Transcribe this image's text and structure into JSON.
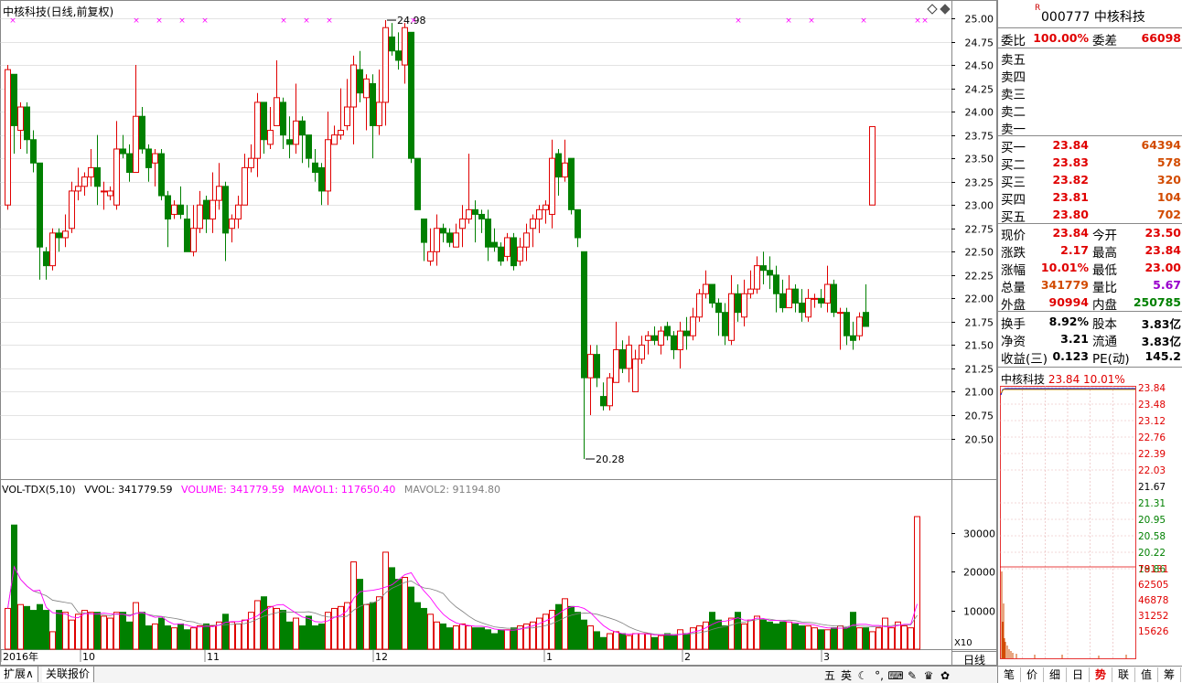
{
  "window": {
    "chart_title": "中核科技(日线,前复权)",
    "period_label": "日线"
  },
  "vol_header": {
    "name": "VOL-TDX(5,10)",
    "vvol": "VVOL: 341779.59",
    "volume": "VOLUME: 341779.59",
    "mavol1": "MAVOL1: 117650.40",
    "mavol2": "MAVOL2: 91194.80"
  },
  "colors": {
    "up": "#e00000",
    "down": "#008000",
    "ma1": "#ff00ff",
    "ma2": "#808080",
    "grid": "#c8c8c8"
  },
  "chart_data": [
    {
      "type": "candlestick",
      "title": "中核科技(日线,前复权)",
      "y_ticks": [
        "25.00",
        "24.75",
        "24.50",
        "24.25",
        "24.00",
        "23.75",
        "23.50",
        "23.25",
        "23.00",
        "22.75",
        "22.50",
        "22.25",
        "22.00",
        "21.75",
        "21.50",
        "21.25",
        "21.00",
        "20.75",
        "20.50"
      ],
      "ylim": [
        20.28,
        25.1
      ],
      "annotations": [
        {
          "label": "24.98",
          "value": 24.98
        },
        {
          "label": "20.28",
          "value": 20.28
        }
      ],
      "x_labels": [
        "2016年",
        "10",
        "11",
        "12",
        "1",
        "2",
        "3"
      ],
      "candles": [
        [
          23.0,
          24.45,
          24.5,
          22.95
        ],
        [
          24.4,
          23.85,
          24.1,
          23.55
        ],
        [
          23.8,
          24.05,
          24.1,
          23.6
        ],
        [
          24.05,
          23.7,
          24.1,
          23.55
        ],
        [
          23.7,
          23.45,
          23.8,
          23.35
        ],
        [
          23.45,
          22.55,
          23.45,
          22.2
        ],
        [
          22.5,
          22.35,
          22.55,
          22.2
        ],
        [
          22.35,
          22.7,
          22.75,
          22.3
        ],
        [
          22.7,
          22.65,
          22.75,
          22.5
        ],
        [
          22.65,
          22.72,
          22.9,
          22.55
        ],
        [
          22.75,
          23.15,
          23.25,
          22.7
        ],
        [
          23.15,
          23.2,
          23.4,
          23.05
        ],
        [
          23.2,
          23.3,
          23.35,
          23.1
        ],
        [
          23.3,
          23.4,
          23.6,
          23.2
        ],
        [
          23.4,
          23.2,
          23.75,
          23.0
        ],
        [
          23.15,
          23.15,
          23.25,
          22.95
        ],
        [
          23.1,
          23.15,
          23.2,
          23.05
        ],
        [
          23.0,
          23.6,
          23.9,
          22.95
        ],
        [
          23.6,
          23.55,
          23.75,
          23.5
        ],
        [
          23.55,
          23.35,
          23.65,
          23.25
        ],
        [
          23.35,
          23.95,
          24.5,
          23.35
        ],
        [
          23.95,
          23.6,
          24.05,
          23.55
        ],
        [
          23.6,
          23.4,
          23.65,
          23.25
        ],
        [
          23.45,
          23.55,
          23.6,
          23.2
        ],
        [
          23.55,
          23.1,
          23.6,
          23.05
        ],
        [
          23.1,
          22.85,
          23.15,
          22.55
        ],
        [
          22.9,
          23.0,
          23.05,
          22.85
        ],
        [
          23.0,
          22.9,
          23.2,
          22.85
        ],
        [
          22.85,
          22.5,
          23.0,
          22.5
        ],
        [
          22.5,
          22.75,
          23.0,
          22.45
        ],
        [
          22.75,
          23.0,
          23.15,
          22.7
        ],
        [
          23.05,
          22.85,
          23.1,
          22.7
        ],
        [
          22.85,
          23.05,
          23.35,
          22.7
        ],
        [
          23.05,
          23.2,
          23.45,
          22.95
        ],
        [
          23.2,
          22.7,
          23.25,
          22.4
        ],
        [
          22.75,
          22.85,
          22.9,
          22.6
        ],
        [
          22.85,
          23.0,
          23.1,
          22.75
        ],
        [
          23.0,
          23.4,
          23.55,
          23.0
        ],
        [
          23.4,
          23.5,
          23.65,
          23.35
        ],
        [
          23.5,
          24.1,
          24.2,
          23.3
        ],
        [
          24.1,
          23.7,
          24.1,
          23.55
        ],
        [
          23.65,
          23.8,
          24.05,
          23.6
        ],
        [
          23.85,
          24.15,
          24.55,
          23.85
        ],
        [
          24.1,
          23.75,
          24.15,
          23.6
        ],
        [
          23.7,
          23.65,
          23.95,
          23.5
        ],
        [
          23.65,
          23.9,
          24.3,
          23.55
        ],
        [
          23.9,
          23.75,
          23.95,
          23.45
        ],
        [
          23.75,
          23.5,
          23.75,
          23.4
        ],
        [
          23.45,
          23.35,
          23.6,
          23.25
        ],
        [
          23.4,
          23.15,
          23.45,
          23.0
        ],
        [
          23.15,
          23.7,
          24.0,
          23.0
        ],
        [
          23.65,
          23.75,
          23.85,
          23.7
        ],
        [
          23.75,
          23.8,
          24.25,
          23.7
        ],
        [
          23.85,
          24.05,
          24.35,
          23.8
        ],
        [
          24.05,
          24.5,
          24.6,
          23.65
        ],
        [
          24.45,
          24.2,
          24.65,
          24.1
        ],
        [
          24.15,
          24.35,
          24.4,
          23.8
        ],
        [
          24.3,
          23.85,
          24.4,
          23.5
        ],
        [
          23.85,
          24.1,
          24.45,
          23.75
        ],
        [
          24.1,
          24.9,
          24.98,
          23.85
        ],
        [
          24.8,
          24.65,
          24.95,
          24.6
        ],
        [
          24.65,
          24.55,
          24.85,
          24.45
        ],
        [
          24.5,
          24.9,
          24.95,
          24.3
        ],
        [
          24.85,
          23.5,
          24.85,
          23.45
        ],
        [
          23.5,
          22.95,
          23.5,
          22.95
        ],
        [
          22.85,
          22.6,
          22.85,
          22.4
        ],
        [
          22.4,
          22.5,
          22.75,
          22.35
        ],
        [
          22.5,
          22.75,
          22.9,
          22.35
        ],
        [
          22.75,
          22.7,
          22.8,
          22.6
        ],
        [
          22.7,
          22.6,
          22.75,
          22.55
        ],
        [
          22.55,
          22.7,
          22.8,
          22.55
        ],
        [
          22.75,
          22.85,
          23.0,
          22.55
        ],
        [
          22.85,
          22.95,
          23.55,
          22.8
        ],
        [
          22.95,
          22.9,
          23.05,
          22.6
        ],
        [
          22.9,
          22.85,
          22.95,
          22.7
        ],
        [
          22.85,
          22.55,
          22.95,
          22.4
        ],
        [
          22.6,
          22.55,
          22.75,
          22.5
        ],
        [
          22.55,
          22.4,
          22.6,
          22.35
        ],
        [
          22.45,
          22.65,
          22.7,
          22.4
        ],
        [
          22.65,
          22.35,
          22.7,
          22.3
        ],
        [
          22.4,
          22.55,
          22.65,
          22.35
        ],
        [
          22.55,
          22.7,
          22.8,
          22.4
        ],
        [
          22.75,
          22.85,
          22.9,
          22.55
        ],
        [
          22.85,
          22.95,
          23.0,
          22.7
        ],
        [
          22.95,
          23.0,
          23.05,
          22.8
        ],
        [
          22.9,
          23.5,
          23.7,
          22.75
        ],
        [
          23.55,
          23.3,
          23.6,
          23.1
        ],
        [
          23.3,
          23.45,
          23.7,
          23.25
        ],
        [
          23.5,
          22.95,
          23.5,
          22.9
        ],
        [
          22.95,
          22.65,
          22.95,
          22.55
        ],
        [
          22.5,
          21.15,
          22.5,
          20.28
        ],
        [
          21.15,
          21.4,
          21.5,
          20.75
        ],
        [
          21.4,
          21.15,
          21.5,
          21.05
        ],
        [
          20.95,
          20.85,
          21.1,
          20.8
        ],
        [
          20.85,
          21.15,
          21.2,
          20.8
        ],
        [
          21.1,
          21.45,
          21.75,
          21.1
        ],
        [
          21.45,
          21.25,
          21.55,
          21.2
        ],
        [
          21.25,
          21.5,
          21.6,
          21.1
        ],
        [
          21.0,
          21.35,
          21.45,
          21.0
        ],
        [
          21.35,
          21.5,
          21.6,
          21.3
        ],
        [
          21.55,
          21.6,
          21.65,
          21.4
        ],
        [
          21.6,
          21.55,
          21.7,
          21.5
        ],
        [
          21.5,
          21.65,
          21.7,
          21.4
        ],
        [
          21.7,
          21.6,
          21.75,
          21.55
        ],
        [
          21.6,
          21.45,
          21.65,
          21.35
        ],
        [
          21.45,
          21.65,
          21.75,
          21.25
        ],
        [
          21.65,
          21.6,
          21.8,
          21.45
        ],
        [
          21.6,
          21.8,
          21.9,
          21.55
        ],
        [
          21.8,
          22.05,
          22.1,
          21.75
        ],
        [
          22.05,
          22.15,
          22.3,
          22.0
        ],
        [
          22.15,
          21.95,
          22.15,
          21.9
        ],
        [
          21.95,
          21.85,
          22.0,
          21.6
        ],
        [
          21.85,
          21.6,
          21.95,
          21.5
        ],
        [
          21.55,
          22.05,
          22.25,
          21.5
        ],
        [
          22.05,
          21.85,
          22.15,
          21.75
        ],
        [
          21.8,
          22.05,
          22.2,
          21.7
        ],
        [
          22.05,
          22.1,
          22.3,
          22.0
        ],
        [
          22.1,
          22.35,
          22.45,
          22.05
        ],
        [
          22.35,
          22.3,
          22.5,
          22.15
        ],
        [
          22.3,
          22.25,
          22.45,
          22.1
        ],
        [
          22.25,
          22.05,
          22.35,
          21.85
        ],
        [
          22.05,
          21.9,
          22.2,
          21.85
        ],
        [
          21.9,
          22.1,
          22.25,
          21.9
        ],
        [
          22.1,
          21.95,
          22.15,
          21.85
        ],
        [
          21.95,
          21.85,
          22.1,
          21.75
        ],
        [
          21.8,
          22.0,
          22.1,
          21.75
        ],
        [
          22.0,
          22.0,
          22.05,
          21.9
        ],
        [
          22.0,
          21.95,
          22.1,
          21.9
        ],
        [
          21.95,
          22.15,
          22.35,
          21.85
        ],
        [
          22.15,
          21.85,
          22.2,
          21.8
        ],
        [
          21.85,
          21.85,
          21.9,
          21.45
        ],
        [
          21.85,
          21.6,
          21.9,
          21.5
        ],
        [
          21.6,
          21.55,
          21.75,
          21.45
        ],
        [
          21.6,
          21.8,
          21.85,
          21.55
        ],
        [
          21.85,
          21.7,
          22.15,
          21.7
        ],
        [
          23.0,
          23.84,
          23.84,
          23.0
        ]
      ]
    },
    {
      "type": "bar",
      "title": "VOL-TDX(5,10)",
      "y_ticks": [
        "30000",
        "20000",
        "10000"
      ],
      "ylim": [
        0,
        35000
      ],
      "unit_label": "X10",
      "values": [
        10500,
        32000,
        11500,
        11000,
        10000,
        11500,
        10000,
        4500,
        10000,
        9500,
        7500,
        9000,
        10000,
        9500,
        9500,
        8500,
        8000,
        9500,
        9500,
        7000,
        12000,
        9500,
        6000,
        6500,
        8000,
        6000,
        5500,
        6500,
        5000,
        5500,
        6000,
        6500,
        6000,
        7000,
        9000,
        7000,
        6500,
        7500,
        9500,
        12500,
        13500,
        11000,
        10500,
        10000,
        7000,
        8000,
        6000,
        8500,
        6000,
        6500,
        9500,
        10500,
        11000,
        12000,
        22500,
        18000,
        11500,
        12000,
        13500,
        25000,
        21000,
        18000,
        18500,
        16000,
        12000,
        10500,
        9000,
        7000,
        6500,
        5500,
        6000,
        6500,
        6000,
        5500,
        5500,
        5000,
        4000,
        5000,
        5000,
        5500,
        6000,
        6500,
        7000,
        8000,
        9000,
        10000,
        11500,
        13000,
        11000,
        9500,
        7500,
        6000,
        4500,
        3000,
        4000,
        4500,
        4000,
        3500,
        4000,
        4000,
        4000,
        3000,
        3500,
        4000,
        3500,
        5000,
        4000,
        5500,
        6000,
        7000,
        9500,
        7500,
        6000,
        8000,
        9500,
        6500,
        7500,
        8500,
        7500,
        7000,
        6500,
        7000,
        7000,
        6500,
        6000,
        6000,
        5500,
        5000,
        5000,
        5500,
        6000,
        5500,
        9500,
        5500,
        5500,
        4500,
        5500,
        8000,
        5500,
        7000,
        6000,
        5500,
        34177
      ]
    },
    {
      "type": "line",
      "title": "中核科技",
      "subtitle_price": "23.84",
      "subtitle_pct": "10.01%",
      "y_ticks_up": [
        "23.84",
        "23.48",
        "23.12",
        "22.76",
        "22.39",
        "22.03"
      ],
      "y_mid": "21.67",
      "y_ticks_down": [
        "21.31",
        "20.95",
        "20.58",
        "20.22",
        "19.86"
      ],
      "vol_ticks": [
        "78131",
        "62505",
        "46878",
        "31252",
        "15626"
      ]
    }
  ],
  "bottom_tabs": [
    "扩展∧",
    "关联报价"
  ],
  "tray_icons": [
    "五",
    "英",
    "☾",
    "°,",
    "⌨",
    "✎",
    "♛",
    "✿"
  ],
  "panel": {
    "code": "000777",
    "name": "中核科技",
    "rmark": "R",
    "weibi_label": "委比",
    "weibi": "100.00%",
    "weicha_label": "委差",
    "weicha": "66098",
    "sells": [
      {
        "label": "卖五",
        "price": "",
        "vol": ""
      },
      {
        "label": "卖四",
        "price": "",
        "vol": ""
      },
      {
        "label": "卖三",
        "price": "",
        "vol": ""
      },
      {
        "label": "卖二",
        "price": "",
        "vol": ""
      },
      {
        "label": "卖一",
        "price": "",
        "vol": ""
      }
    ],
    "buys": [
      {
        "label": "买一",
        "price": "23.84",
        "vol": "64394"
      },
      {
        "label": "买二",
        "price": "23.83",
        "vol": "578"
      },
      {
        "label": "买三",
        "price": "23.82",
        "vol": "320"
      },
      {
        "label": "买四",
        "price": "23.81",
        "vol": "104"
      },
      {
        "label": "买五",
        "price": "23.80",
        "vol": "702"
      }
    ],
    "quote_rows": [
      {
        "l1": "现价",
        "v1": "23.84",
        "c1": "red",
        "l2": "今开",
        "v2": "23.50",
        "c2": "red"
      },
      {
        "l1": "涨跌",
        "v1": "2.17",
        "c1": "red",
        "l2": "最高",
        "v2": "23.84",
        "c2": "red"
      },
      {
        "l1": "涨幅",
        "v1": "10.01%",
        "c1": "red",
        "l2": "最低",
        "v2": "23.00",
        "c2": "red"
      },
      {
        "l1": "总量",
        "v1": "341779",
        "c1": "orange",
        "l2": "量比",
        "v2": "5.67",
        "c2": "purple"
      },
      {
        "l1": "外盘",
        "v1": "90994",
        "c1": "red",
        "l2": "内盘",
        "v2": "250785",
        "c2": "green"
      }
    ],
    "fin_rows": [
      {
        "l1": "换手",
        "v1": "8.92%",
        "l2": "股本",
        "v2": "3.83亿"
      },
      {
        "l1": "净资",
        "v1": "3.21",
        "l2": "流通",
        "v2": "3.83亿"
      },
      {
        "l1": "收益(三)",
        "v1": "0.123",
        "l2": "PE(动)",
        "v2": "145.2"
      }
    ],
    "tabs": [
      "笔",
      "价",
      "细",
      "日",
      "势",
      "联",
      "值",
      "筹"
    ]
  }
}
